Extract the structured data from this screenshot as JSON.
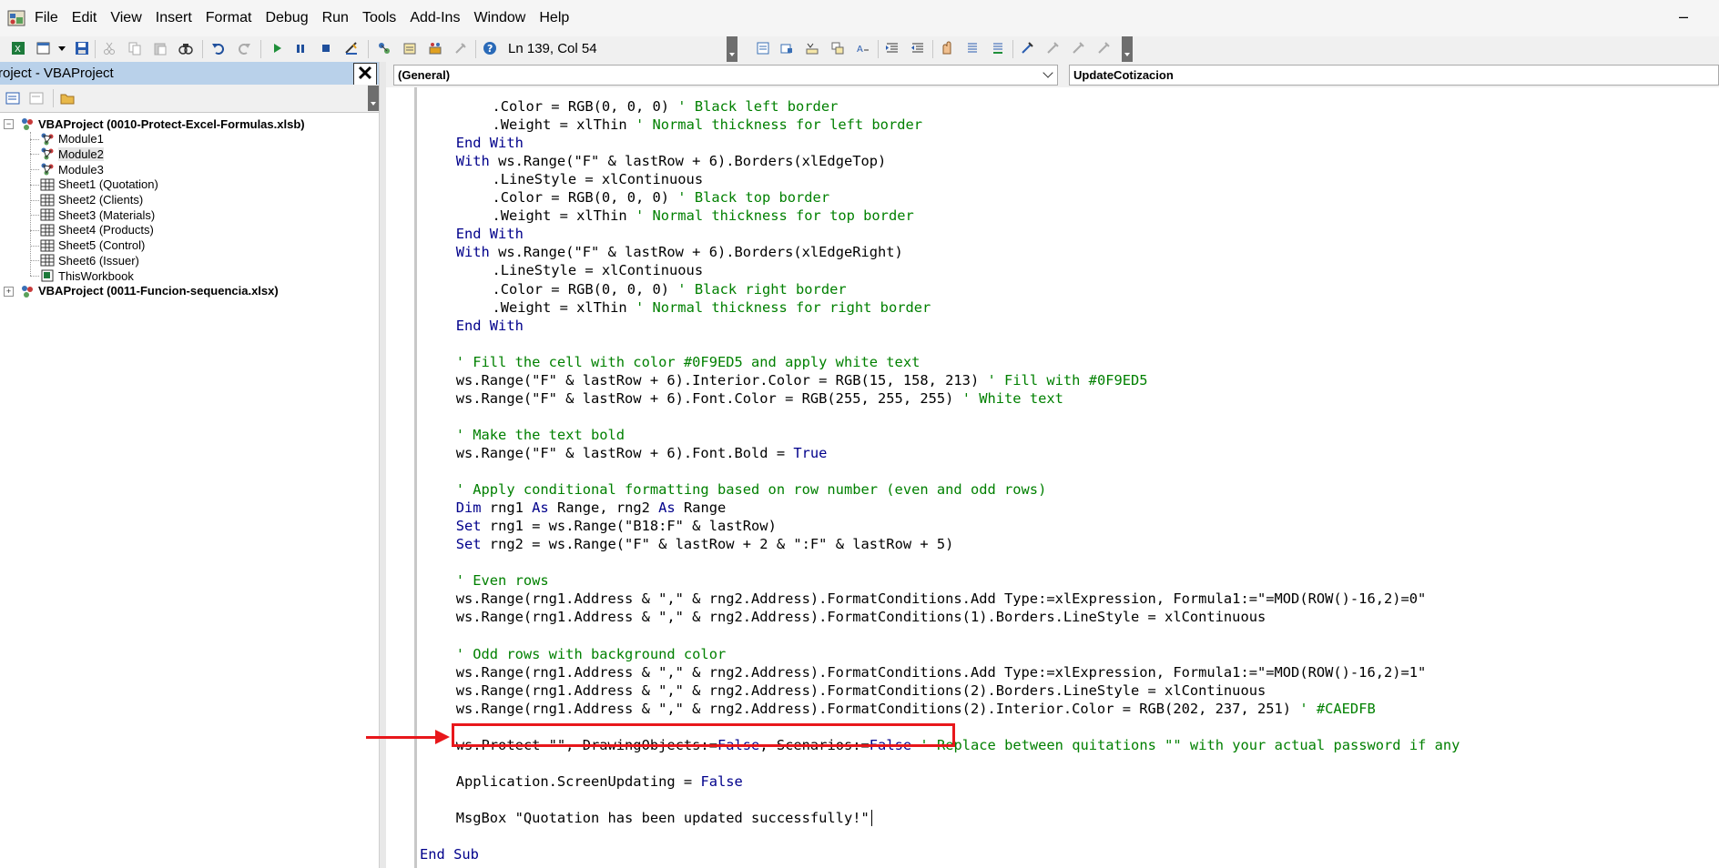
{
  "menu": {
    "items": [
      "File",
      "Edit",
      "View",
      "Insert",
      "Format",
      "Debug",
      "Run",
      "Tools",
      "Add-Ins",
      "Window",
      "Help"
    ],
    "minimize": "–"
  },
  "toolbar": {
    "cursor_position": "Ln 139, Col 54"
  },
  "project": {
    "title": "Project - VBAProject",
    "close": "✕",
    "tree": [
      {
        "label": "VBAProject (0010-Protect-Excel-Formulas.xlsb)",
        "icon": "project-icon",
        "level": 0,
        "bold": true,
        "expander": "−"
      },
      {
        "label": "Module1",
        "icon": "module-icon",
        "level": 1
      },
      {
        "label": "Module2",
        "icon": "module-icon",
        "level": 1,
        "selected": true
      },
      {
        "label": "Module3",
        "icon": "module-icon",
        "level": 1
      },
      {
        "label": "Sheet1 (Quotation)",
        "icon": "sheet-icon",
        "level": 1
      },
      {
        "label": "Sheet2 (Clients)",
        "icon": "sheet-icon",
        "level": 1
      },
      {
        "label": "Sheet3 (Materials)",
        "icon": "sheet-icon",
        "level": 1
      },
      {
        "label": "Sheet4 (Products)",
        "icon": "sheet-icon",
        "level": 1
      },
      {
        "label": "Sheet5 (Control)",
        "icon": "sheet-icon",
        "level": 1
      },
      {
        "label": "Sheet6 (Issuer)",
        "icon": "sheet-icon",
        "level": 1
      },
      {
        "label": "ThisWorkbook",
        "icon": "workbook-icon",
        "level": 1
      },
      {
        "label": "VBAProject (0011-Funcion-sequencia.xlsx)",
        "icon": "project-icon",
        "level": 0,
        "bold": true,
        "expander": "+"
      }
    ]
  },
  "editor": {
    "object_combo": "(General)",
    "procedure_combo": "UpdateCotizacion",
    "lines": [
      {
        "indent": 8,
        "segments": [
          {
            "t": ".Color = RGB(0, 0, 0) "
          },
          {
            "t": "' Black left border",
            "c": "cm"
          }
        ]
      },
      {
        "indent": 8,
        "segments": [
          {
            "t": ".Weight = xlThin "
          },
          {
            "t": "' Normal thickness for left border",
            "c": "cm"
          }
        ]
      },
      {
        "indent": 4,
        "segments": [
          {
            "t": "End With",
            "c": "kw"
          }
        ]
      },
      {
        "indent": 4,
        "segments": [
          {
            "t": "With",
            "c": "kw"
          },
          {
            "t": " ws.Range(\"F\" & lastRow + 6).Borders(xlEdgeTop)"
          }
        ]
      },
      {
        "indent": 8,
        "segments": [
          {
            "t": ".LineStyle = xlContinuous"
          }
        ]
      },
      {
        "indent": 8,
        "segments": [
          {
            "t": ".Color = RGB(0, 0, 0) "
          },
          {
            "t": "' Black top border",
            "c": "cm"
          }
        ]
      },
      {
        "indent": 8,
        "segments": [
          {
            "t": ".Weight = xlThin "
          },
          {
            "t": "' Normal thickness for top border",
            "c": "cm"
          }
        ]
      },
      {
        "indent": 4,
        "segments": [
          {
            "t": "End With",
            "c": "kw"
          }
        ]
      },
      {
        "indent": 4,
        "segments": [
          {
            "t": "With",
            "c": "kw"
          },
          {
            "t": " ws.Range(\"F\" & lastRow + 6).Borders(xlEdgeRight)"
          }
        ]
      },
      {
        "indent": 8,
        "segments": [
          {
            "t": ".LineStyle = xlContinuous"
          }
        ]
      },
      {
        "indent": 8,
        "segments": [
          {
            "t": ".Color = RGB(0, 0, 0) "
          },
          {
            "t": "' Black right border",
            "c": "cm"
          }
        ]
      },
      {
        "indent": 8,
        "segments": [
          {
            "t": ".Weight = xlThin "
          },
          {
            "t": "' Normal thickness for right border",
            "c": "cm"
          }
        ]
      },
      {
        "indent": 4,
        "segments": [
          {
            "t": "End With",
            "c": "kw"
          }
        ]
      },
      {
        "indent": 0,
        "segments": []
      },
      {
        "indent": 4,
        "segments": [
          {
            "t": "' Fill the cell with color #0F9ED5 and apply white text",
            "c": "cm"
          }
        ]
      },
      {
        "indent": 4,
        "segments": [
          {
            "t": "ws.Range(\"F\" & lastRow + 6).Interior.Color = RGB(15, 158, 213) "
          },
          {
            "t": "' Fill with #0F9ED5",
            "c": "cm"
          }
        ]
      },
      {
        "indent": 4,
        "segments": [
          {
            "t": "ws.Range(\"F\" & lastRow + 6).Font.Color = RGB(255, 255, 255) "
          },
          {
            "t": "' White text",
            "c": "cm"
          }
        ]
      },
      {
        "indent": 0,
        "segments": []
      },
      {
        "indent": 4,
        "segments": [
          {
            "t": "' Make the text bold",
            "c": "cm"
          }
        ]
      },
      {
        "indent": 4,
        "segments": [
          {
            "t": "ws.Range(\"F\" & lastRow + 6).Font.Bold = "
          },
          {
            "t": "True",
            "c": "kw"
          }
        ]
      },
      {
        "indent": 0,
        "segments": []
      },
      {
        "indent": 4,
        "segments": [
          {
            "t": "' Apply conditional formatting based on row number (even and odd rows)",
            "c": "cm"
          }
        ]
      },
      {
        "indent": 4,
        "segments": [
          {
            "t": "Dim",
            "c": "kw"
          },
          {
            "t": " rng1 "
          },
          {
            "t": "As",
            "c": "kw"
          },
          {
            "t": " Range, rng2 "
          },
          {
            "t": "As",
            "c": "kw"
          },
          {
            "t": " Range"
          }
        ]
      },
      {
        "indent": 4,
        "segments": [
          {
            "t": "Set",
            "c": "kw"
          },
          {
            "t": " rng1 = ws.Range(\"B18:F\" & lastRow)"
          }
        ]
      },
      {
        "indent": 4,
        "segments": [
          {
            "t": "Set",
            "c": "kw"
          },
          {
            "t": " rng2 = ws.Range(\"F\" & lastRow + 2 & \":F\" & lastRow + 5)"
          }
        ]
      },
      {
        "indent": 0,
        "segments": []
      },
      {
        "indent": 4,
        "segments": [
          {
            "t": "' Even rows",
            "c": "cm"
          }
        ]
      },
      {
        "indent": 4,
        "segments": [
          {
            "t": "ws.Range(rng1.Address & \",\" & rng2.Address).FormatConditions.Add Type:=xlExpression, Formula1:=\"=MOD(ROW()-16,2)=0\""
          }
        ]
      },
      {
        "indent": 4,
        "segments": [
          {
            "t": "ws.Range(rng1.Address & \",\" & rng2.Address).FormatConditions(1).Borders.LineStyle = xlContinuous"
          }
        ]
      },
      {
        "indent": 0,
        "segments": []
      },
      {
        "indent": 4,
        "segments": [
          {
            "t": "' Odd rows with background color",
            "c": "cm"
          }
        ]
      },
      {
        "indent": 4,
        "segments": [
          {
            "t": "ws.Range(rng1.Address & \",\" & rng2.Address).FormatConditions.Add Type:=xlExpression, Formula1:=\"=MOD(ROW()-16,2)=1\""
          }
        ]
      },
      {
        "indent": 4,
        "segments": [
          {
            "t": "ws.Range(rng1.Address & \",\" & rng2.Address).FormatConditions(2).Borders.LineStyle = xlContinuous"
          }
        ]
      },
      {
        "indent": 4,
        "segments": [
          {
            "t": "ws.Range(rng1.Address & \",\" & rng2.Address).FormatConditions(2).Interior.Color = RGB(202, 237, 251) "
          },
          {
            "t": "' #CAEDFB",
            "c": "cm"
          }
        ]
      },
      {
        "indent": 0,
        "segments": []
      },
      {
        "indent": 4,
        "segments": [
          {
            "t": "ws.Protect \"\", DrawingObjects:="
          },
          {
            "t": "False",
            "c": "kw"
          },
          {
            "t": ", Scenarios:="
          },
          {
            "t": "False",
            "c": "kw"
          },
          {
            "t": " "
          },
          {
            "t": "' Replace between quitations \"\" with your actual password if any",
            "c": "cm"
          }
        ]
      },
      {
        "indent": 0,
        "segments": []
      },
      {
        "indent": 4,
        "segments": [
          {
            "t": "Application.ScreenUpdating = "
          },
          {
            "t": "False",
            "c": "kw"
          }
        ]
      },
      {
        "indent": 0,
        "segments": []
      },
      {
        "indent": 4,
        "segments": [
          {
            "t": "MsgBox \"Quotation has been updated successfully!\""
          }
        ],
        "caret": true
      },
      {
        "indent": 0,
        "segments": []
      },
      {
        "indent": 0,
        "segments": [
          {
            "t": "End Sub",
            "c": "kw"
          }
        ]
      }
    ]
  },
  "colors": {
    "keyword": "#00008b",
    "comment": "#008000",
    "highlight": "#e8171b",
    "title_bar": "#b9d1ea"
  }
}
